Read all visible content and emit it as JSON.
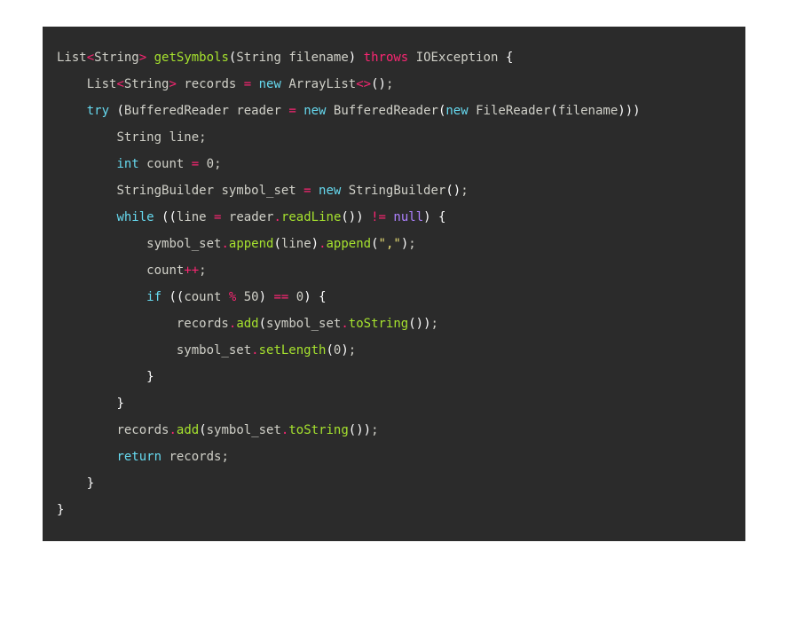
{
  "code": {
    "lines": [
      {
        "indent": 0,
        "tokens": [
          {
            "c": "t-type",
            "t": "List"
          },
          {
            "c": "t-punc",
            "t": "<"
          },
          {
            "c": "t-type",
            "t": "String"
          },
          {
            "c": "t-punc",
            "t": ">"
          },
          {
            "c": "",
            "t": " "
          },
          {
            "c": "t-fn",
            "t": "getSymbols"
          },
          {
            "c": "t-paren",
            "t": "("
          },
          {
            "c": "t-type",
            "t": "String filename"
          },
          {
            "c": "t-paren",
            "t": ")"
          },
          {
            "c": "",
            "t": " "
          },
          {
            "c": "t-fnthrow",
            "t": "throws"
          },
          {
            "c": "",
            "t": " IOException "
          },
          {
            "c": "t-brace",
            "t": "{"
          }
        ]
      },
      {
        "indent": 1,
        "tokens": [
          {
            "c": "t-type",
            "t": "List"
          },
          {
            "c": "t-punc",
            "t": "<"
          },
          {
            "c": "t-type",
            "t": "String"
          },
          {
            "c": "t-punc",
            "t": ">"
          },
          {
            "c": "",
            "t": " records "
          },
          {
            "c": "t-punc",
            "t": "="
          },
          {
            "c": "",
            "t": " "
          },
          {
            "c": "t-keyword",
            "t": "new"
          },
          {
            "c": "",
            "t": " ArrayList"
          },
          {
            "c": "t-punc",
            "t": "<>"
          },
          {
            "c": "t-paren",
            "t": "()"
          },
          {
            "c": "t-semi",
            "t": ";"
          }
        ]
      },
      {
        "indent": 1,
        "tokens": [
          {
            "c": "t-keyword",
            "t": "try"
          },
          {
            "c": "",
            "t": " "
          },
          {
            "c": "t-paren",
            "t": "("
          },
          {
            "c": "t-type",
            "t": "BufferedReader reader "
          },
          {
            "c": "t-punc",
            "t": "="
          },
          {
            "c": "",
            "t": " "
          },
          {
            "c": "t-keyword",
            "t": "new"
          },
          {
            "c": "",
            "t": " BufferedReader"
          },
          {
            "c": "t-paren",
            "t": "("
          },
          {
            "c": "t-keyword",
            "t": "new"
          },
          {
            "c": "",
            "t": " FileReader"
          },
          {
            "c": "t-paren",
            "t": "("
          },
          {
            "c": "",
            "t": "filename"
          },
          {
            "c": "t-paren",
            "t": "))"
          },
          {
            "c": "t-paren",
            "t": ")"
          }
        ]
      },
      {
        "indent": 2,
        "tokens": [
          {
            "c": "t-type",
            "t": "String line"
          },
          {
            "c": "t-semi",
            "t": ";"
          }
        ]
      },
      {
        "indent": 2,
        "tokens": [
          {
            "c": "t-keyword",
            "t": "int"
          },
          {
            "c": "",
            "t": " count "
          },
          {
            "c": "t-punc",
            "t": "="
          },
          {
            "c": "",
            "t": " "
          },
          {
            "c": "",
            "t": "0"
          },
          {
            "c": "t-semi",
            "t": ";"
          }
        ]
      },
      {
        "indent": 2,
        "tokens": [
          {
            "c": "t-type",
            "t": "StringBuilder symbol_set "
          },
          {
            "c": "t-punc",
            "t": "="
          },
          {
            "c": "",
            "t": " "
          },
          {
            "c": "t-keyword",
            "t": "new"
          },
          {
            "c": "",
            "t": " StringBuilder"
          },
          {
            "c": "t-paren",
            "t": "()"
          },
          {
            "c": "t-semi",
            "t": ";"
          }
        ]
      },
      {
        "indent": 2,
        "tokens": [
          {
            "c": "t-keyword",
            "t": "while"
          },
          {
            "c": "",
            "t": " "
          },
          {
            "c": "t-paren",
            "t": "(("
          },
          {
            "c": "",
            "t": "line "
          },
          {
            "c": "t-punc",
            "t": "="
          },
          {
            "c": "",
            "t": " reader"
          },
          {
            "c": "t-punc",
            "t": "."
          },
          {
            "c": "t-fn",
            "t": "readLine"
          },
          {
            "c": "t-paren",
            "t": "())"
          },
          {
            "c": "",
            "t": " "
          },
          {
            "c": "t-punc",
            "t": "!="
          },
          {
            "c": "",
            "t": " "
          },
          {
            "c": "t-num",
            "t": "null"
          },
          {
            "c": "t-paren",
            "t": ")"
          },
          {
            "c": "",
            "t": " "
          },
          {
            "c": "t-brace",
            "t": "{"
          }
        ]
      },
      {
        "indent": 3,
        "tokens": [
          {
            "c": "",
            "t": "symbol_set"
          },
          {
            "c": "t-punc",
            "t": "."
          },
          {
            "c": "t-fn",
            "t": "append"
          },
          {
            "c": "t-paren",
            "t": "("
          },
          {
            "c": "",
            "t": "line"
          },
          {
            "c": "t-paren",
            "t": ")"
          },
          {
            "c": "t-punc",
            "t": "."
          },
          {
            "c": "t-fn",
            "t": "append"
          },
          {
            "c": "t-paren",
            "t": "("
          },
          {
            "c": "t-str",
            "t": "\",\""
          },
          {
            "c": "t-paren",
            "t": ")"
          },
          {
            "c": "t-semi",
            "t": ";"
          }
        ]
      },
      {
        "indent": 3,
        "tokens": [
          {
            "c": "",
            "t": "count"
          },
          {
            "c": "t-plus",
            "t": "++"
          },
          {
            "c": "t-semi",
            "t": ";"
          }
        ]
      },
      {
        "indent": 3,
        "tokens": [
          {
            "c": "t-keyword",
            "t": "if"
          },
          {
            "c": "",
            "t": " "
          },
          {
            "c": "t-paren",
            "t": "(("
          },
          {
            "c": "",
            "t": "count "
          },
          {
            "c": "t-punc",
            "t": "%"
          },
          {
            "c": "",
            "t": " 50"
          },
          {
            "c": "t-paren",
            "t": ")"
          },
          {
            "c": "",
            "t": " "
          },
          {
            "c": "t-punc",
            "t": "=="
          },
          {
            "c": "",
            "t": " 0"
          },
          {
            "c": "t-paren",
            "t": ")"
          },
          {
            "c": "",
            "t": " "
          },
          {
            "c": "t-brace",
            "t": "{"
          }
        ]
      },
      {
        "indent": 4,
        "tokens": [
          {
            "c": "",
            "t": "records"
          },
          {
            "c": "t-punc",
            "t": "."
          },
          {
            "c": "t-fn",
            "t": "add"
          },
          {
            "c": "t-paren",
            "t": "("
          },
          {
            "c": "",
            "t": "symbol_set"
          },
          {
            "c": "t-punc",
            "t": "."
          },
          {
            "c": "t-fn",
            "t": "toString"
          },
          {
            "c": "t-paren",
            "t": "())"
          },
          {
            "c": "t-semi",
            "t": ";"
          }
        ]
      },
      {
        "indent": 4,
        "tokens": [
          {
            "c": "",
            "t": "symbol_set"
          },
          {
            "c": "t-punc",
            "t": "."
          },
          {
            "c": "t-fn",
            "t": "setLength"
          },
          {
            "c": "t-paren",
            "t": "("
          },
          {
            "c": "",
            "t": "0"
          },
          {
            "c": "t-paren",
            "t": ")"
          },
          {
            "c": "t-semi",
            "t": ";"
          }
        ]
      },
      {
        "indent": 3,
        "tokens": [
          {
            "c": "t-brace",
            "t": "}"
          }
        ]
      },
      {
        "indent": 2,
        "tokens": [
          {
            "c": "t-brace",
            "t": "}"
          }
        ]
      },
      {
        "indent": 2,
        "tokens": [
          {
            "c": "",
            "t": "records"
          },
          {
            "c": "t-punc",
            "t": "."
          },
          {
            "c": "t-fn",
            "t": "add"
          },
          {
            "c": "t-paren",
            "t": "("
          },
          {
            "c": "",
            "t": "symbol_set"
          },
          {
            "c": "t-punc",
            "t": "."
          },
          {
            "c": "t-fn",
            "t": "toString"
          },
          {
            "c": "t-paren",
            "t": "())"
          },
          {
            "c": "t-semi",
            "t": ";"
          }
        ]
      },
      {
        "indent": 2,
        "tokens": [
          {
            "c": "t-keyword",
            "t": "return"
          },
          {
            "c": "",
            "t": " records"
          },
          {
            "c": "t-semi",
            "t": ";"
          }
        ]
      },
      {
        "indent": 1,
        "tokens": [
          {
            "c": "t-brace",
            "t": "}"
          }
        ]
      },
      {
        "indent": 0,
        "tokens": [
          {
            "c": "t-brace",
            "t": "}"
          }
        ]
      }
    ]
  },
  "plain_source": "List<String> getSymbols(String filename) throws IOException {\n    List<String> records = new ArrayList<>();\n    try (BufferedReader reader = new BufferedReader(new FileReader(filename)))\n        String line;\n        int count = 0;\n        StringBuilder symbol_set = new StringBuilder();\n        while ((line = reader.readLine()) != null) {\n            symbol_set.append(line).append(\",\");\n            count++;\n            if ((count % 50) == 0) {\n                records.add(symbol_set.toString());\n                symbol_set.setLength(0);\n            }\n        }\n        records.add(symbol_set.toString());\n        return records;\n    }\n}"
}
